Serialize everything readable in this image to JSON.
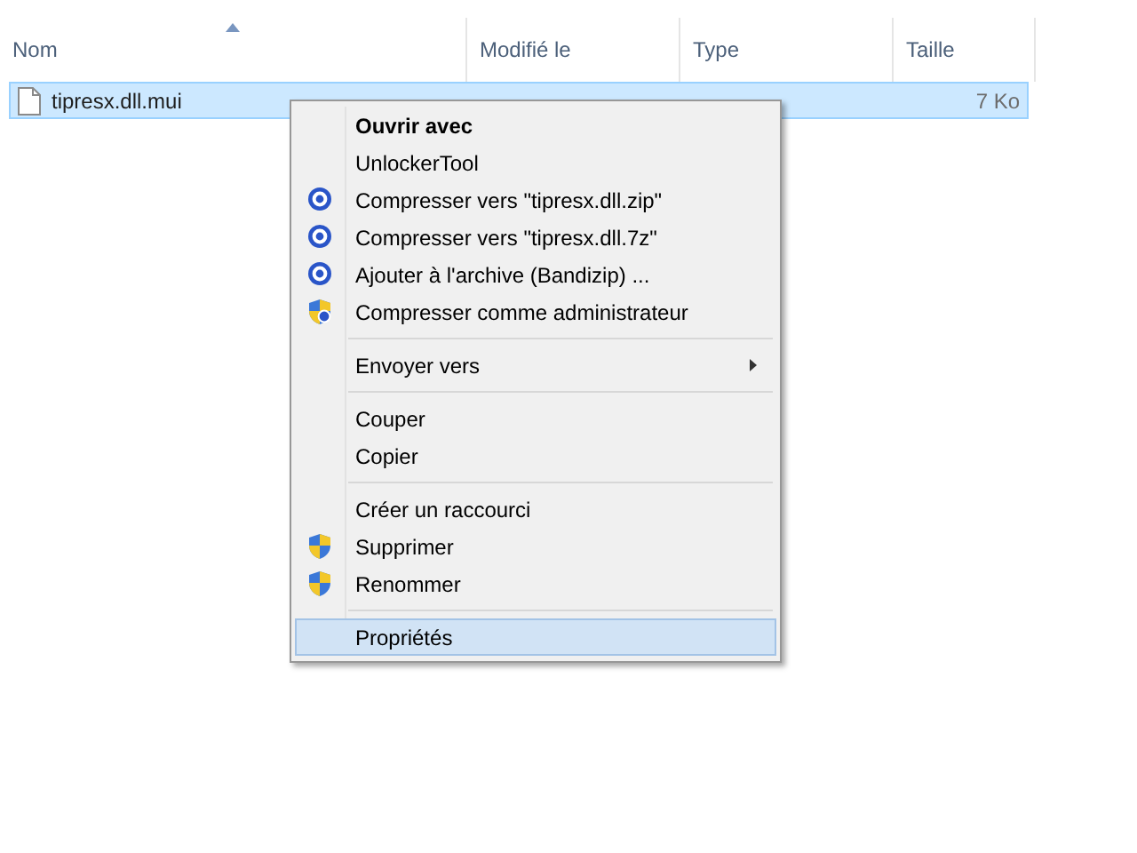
{
  "columns": [
    {
      "label": "Nom",
      "sorted": true
    },
    {
      "label": "Modifié le",
      "sorted": false
    },
    {
      "label": "Type",
      "sorted": false
    },
    {
      "label": "Taille",
      "sorted": false
    }
  ],
  "rows": [
    {
      "name": "tipresx.dll.mui",
      "size": "7 Ko",
      "selected": true
    }
  ],
  "context_menu": [
    {
      "kind": "item",
      "label": "Ouvrir avec",
      "bold": true,
      "submenu": false,
      "selected": false
    },
    {
      "kind": "item",
      "label": "UnlockerTool",
      "bold": false,
      "submenu": false,
      "selected": false
    },
    {
      "kind": "archive",
      "label": "Compresser vers \"tipresx.dll.zip\"",
      "bold": false,
      "submenu": false,
      "selected": false
    },
    {
      "kind": "archive",
      "label": "Compresser vers \"tipresx.dll.7z\"",
      "bold": false,
      "submenu": false,
      "selected": false
    },
    {
      "kind": "archive",
      "label": "Ajouter à l'archive (Bandizip) ...",
      "bold": false,
      "submenu": false,
      "selected": false
    },
    {
      "kind": "admin",
      "label": "Compresser comme administrateur",
      "bold": false,
      "submenu": false,
      "selected": false
    },
    {
      "kind": "separator"
    },
    {
      "kind": "item",
      "label": "Envoyer vers",
      "bold": false,
      "submenu": true,
      "selected": false
    },
    {
      "kind": "separator"
    },
    {
      "kind": "item",
      "label": "Couper",
      "bold": false,
      "submenu": false,
      "selected": false
    },
    {
      "kind": "item",
      "label": "Copier",
      "bold": false,
      "submenu": false,
      "selected": false
    },
    {
      "kind": "separator"
    },
    {
      "kind": "item",
      "label": "Créer un raccourci",
      "bold": false,
      "submenu": false,
      "selected": false
    },
    {
      "kind": "shield",
      "label": "Supprimer",
      "bold": false,
      "submenu": false,
      "selected": false
    },
    {
      "kind": "shield",
      "label": "Renommer",
      "bold": false,
      "submenu": false,
      "selected": false
    },
    {
      "kind": "separator"
    },
    {
      "kind": "item",
      "label": "Propriétés",
      "bold": false,
      "submenu": false,
      "selected": true
    }
  ]
}
